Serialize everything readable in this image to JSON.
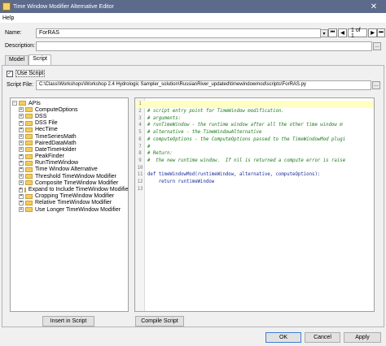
{
  "window": {
    "title": "Time Window Modifier Alternative Editor",
    "close_glyph": "✕",
    "app_icon": "app-icon"
  },
  "menu": {
    "help_label": "Help"
  },
  "form": {
    "name_label": "Name:",
    "name_value": "ForRAS",
    "pager_text": "1 of 1",
    "description_label": "Description:",
    "description_value": ""
  },
  "tabs": [
    {
      "label": "Model",
      "active": false
    },
    {
      "label": "Script",
      "active": true
    }
  ],
  "script_tab": {
    "use_script_label": "Use Script",
    "use_script_checked": true,
    "script_file_label": "Script File:",
    "script_file_value": "C:\\Class\\Workshops\\Workshop 2.4 Hydrologic Sampler_solution\\RussianRiver_updated\\timewindowmod\\scripts\\ForRAS.py"
  },
  "tree": {
    "root": "APIs",
    "items": [
      "ComputeOptions",
      "DSS",
      "DSS File",
      "HecTime",
      "TimeSeriesMath",
      "PairedDataMath",
      "DateTimeHolder",
      "PeakFinder",
      "RunTimeWindow",
      "Time Window Alternative",
      "Threshold TimeWindow Modifier",
      "Composite TimeWindow Modifier",
      "Expand to Include TimeWindow Modifier",
      "Cropping TimeWindow Modifier",
      "Relative TimeWindow Modifier",
      "Use Longer TimeWindow Modifier"
    ]
  },
  "code": {
    "lines": [
      {
        "n": "1",
        "text": "",
        "kind": "plain",
        "hl": true
      },
      {
        "n": "2",
        "text": "# script entry point for TimeWindow modification.",
        "kind": "comment",
        "hl": false
      },
      {
        "n": "3",
        "text": "# arguments:",
        "kind": "comment",
        "hl": false
      },
      {
        "n": "4",
        "text": "# runTimeWindow - the runtime window after all the other time window m",
        "kind": "comment",
        "hl": false
      },
      {
        "n": "5",
        "text": "# alternative - the TimeWindowAlternative",
        "kind": "comment",
        "hl": false
      },
      {
        "n": "6",
        "text": "# computeOptions - the ComputeOptions passed to the TimeWindowMod plugi",
        "kind": "comment",
        "hl": false
      },
      {
        "n": "7",
        "text": "#",
        "kind": "comment",
        "hl": false
      },
      {
        "n": "8",
        "text": "# Return:",
        "kind": "comment",
        "hl": false
      },
      {
        "n": "9",
        "text": "#  the new runtime window.  If nil is returned a compute error is raise",
        "kind": "comment",
        "hl": false
      },
      {
        "n": "10",
        "text": "",
        "kind": "plain",
        "hl": false
      },
      {
        "n": "11",
        "text": "def timeWindowMod(runtimeWindow, alternative, computeOptions):",
        "kind": "kw",
        "hl": false
      },
      {
        "n": "12",
        "text": "    return runtimeWindow",
        "kind": "kw",
        "hl": false
      },
      {
        "n": "13",
        "text": "",
        "kind": "plain",
        "hl": false
      }
    ]
  },
  "buttons": {
    "insert_script": "Insert in Script",
    "compile_script": "Compile Script",
    "ok": "OK",
    "cancel": "Cancel",
    "apply": "Apply"
  },
  "nav_glyphs": {
    "first": "⏮",
    "prev": "◀",
    "next": "▶",
    "last": "⏭",
    "dropdown": "▾",
    "browse": "…"
  }
}
